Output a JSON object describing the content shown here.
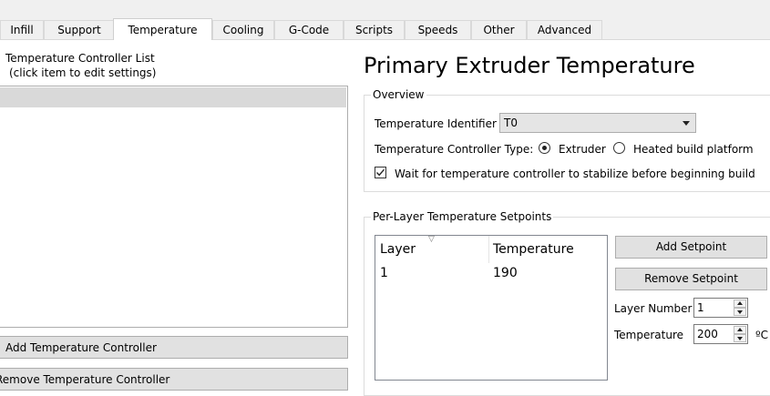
{
  "tabs": [
    {
      "label": "Infill",
      "active": false
    },
    {
      "label": "Support",
      "active": false
    },
    {
      "label": "Temperature",
      "active": true
    },
    {
      "label": "Cooling",
      "active": false
    },
    {
      "label": "G-Code",
      "active": false
    },
    {
      "label": "Scripts",
      "active": false
    },
    {
      "label": "Speeds",
      "active": false
    },
    {
      "label": "Other",
      "active": false
    },
    {
      "label": "Advanced",
      "active": false
    }
  ],
  "left_panel": {
    "list_title_line1": "Temperature Controller List",
    "list_title_line2": "(click item to edit settings)",
    "add_button": "Add Temperature Controller",
    "remove_button": "Remove Temperature Controller"
  },
  "main": {
    "title": "Primary Extruder Temperature",
    "overview": {
      "group_title": "Overview",
      "identifier_label": "Temperature Identifier",
      "identifier_value": "T0",
      "controller_type_label": "Temperature Controller Type:",
      "controller_types": [
        {
          "label": "Extruder",
          "selected": true
        },
        {
          "label": "Heated build platform",
          "selected": false
        }
      ],
      "wait_label": "Wait for temperature controller to stabilize before beginning build",
      "wait_checked": true
    },
    "setpoints": {
      "group_title": "Per-Layer Temperature Setpoints",
      "columns": [
        "Layer",
        "Temperature"
      ],
      "rows": [
        {
          "layer": "1",
          "temperature": "190"
        }
      ],
      "add_button": "Add Setpoint",
      "remove_button": "Remove Setpoint",
      "layer_number_label": "Layer Number",
      "layer_number_value": "1",
      "temperature_label": "Temperature",
      "temperature_value": "200",
      "temperature_unit": "ºC"
    }
  },
  "colors": {
    "tab_bg": "#f0f0f0",
    "button_bg": "#e1e1e1",
    "selection_bg": "#d9d9d9"
  }
}
